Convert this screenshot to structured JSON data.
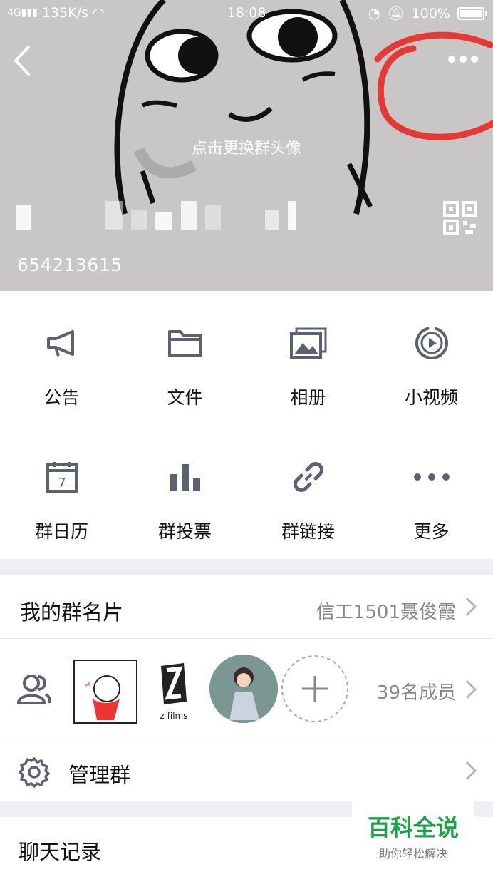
{
  "status_bar": {
    "network_speed": "135K/s",
    "time": "18:08",
    "battery_text": "100%"
  },
  "header": {
    "change_avatar_text": "点击更换群头像",
    "group_id": "654213615",
    "annotation_color": "#e53935"
  },
  "grid": [
    {
      "label": "公告",
      "icon": "megaphone-icon"
    },
    {
      "label": "文件",
      "icon": "folder-icon"
    },
    {
      "label": "相册",
      "icon": "album-icon"
    },
    {
      "label": "小视频",
      "icon": "video-icon"
    },
    {
      "label": "群日历",
      "icon": "calendar-icon",
      "day": "7"
    },
    {
      "label": "群投票",
      "icon": "bar-chart-icon"
    },
    {
      "label": "群链接",
      "icon": "link-icon"
    },
    {
      "label": "更多",
      "icon": "more-dots-icon"
    }
  ],
  "card_row": {
    "title": "我的群名片",
    "value": "信工1501聂俊霞"
  },
  "members_row": {
    "count_text": "39名成员",
    "avatar_caption": "z films"
  },
  "manage_row": {
    "title": "管理群"
  },
  "chat_row": {
    "title": "聊天记录"
  },
  "watermark": {
    "title": "百科全说",
    "subtitle": "助你轻松解决"
  },
  "colors": {
    "icon_gray": "#5c6070",
    "accent_green": "#1ca34a"
  }
}
